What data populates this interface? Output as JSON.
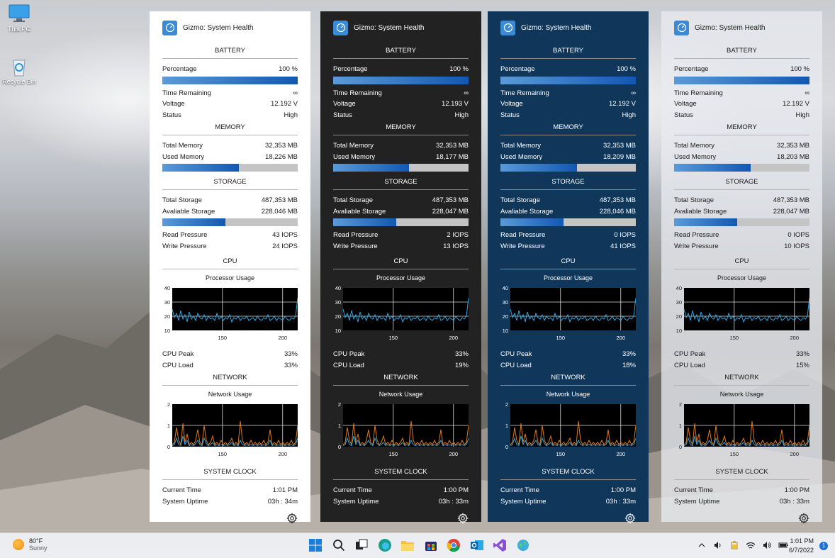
{
  "desktop": {
    "icons": [
      {
        "label": "This PC"
      },
      {
        "label": "Recycle Bin"
      }
    ]
  },
  "widgets": [
    {
      "theme": "light",
      "title": "Gizmo: System Health",
      "battery": {
        "heading": "BATTERY",
        "percentage_label": "Percentage",
        "percentage_value": "100 %",
        "percentage_fill": 1.0,
        "time_label": "Time Remaining",
        "time_value": "∞",
        "voltage_label": "Voltage",
        "voltage_value": "12.192 V",
        "status_label": "Status",
        "status_value": "High"
      },
      "memory": {
        "heading": "MEMORY",
        "total_label": "Total Memory",
        "total_value": "32,353 MB",
        "used_label": "Used Memory",
        "used_value": "18,226 MB",
        "used_fill": 0.563
      },
      "storage": {
        "heading": "STORAGE",
        "total_label": "Total Storage",
        "total_value": "487,353 MB",
        "avail_label": "Avaliable Storage",
        "avail_value": "228,046 MB",
        "avail_fill": 0.468,
        "read_label": "Read Pressure",
        "read_value": "43 IOPS",
        "write_label": "Write Pressure",
        "write_value": "24 IOPS"
      },
      "cpu": {
        "heading": "CPU",
        "chart_title": "Processor Usage",
        "peak_label": "CPU Peak",
        "peak_value": "33%",
        "load_label": "CPU Load",
        "load_value": "33%"
      },
      "network": {
        "heading": "NETWORK",
        "chart_title": "Network Usage"
      },
      "clock": {
        "heading": "SYSTEM CLOCK",
        "time_label": "Current Time",
        "time_value": "1:01 PM",
        "uptime_label": "System Uptime",
        "uptime_value": "03h : 34m"
      }
    },
    {
      "theme": "dark",
      "title": "Gizmo: System Health",
      "battery": {
        "heading": "BATTERY",
        "percentage_label": "Percentage",
        "percentage_value": "100 %",
        "percentage_fill": 1.0,
        "time_label": "Time Remaining",
        "time_value": "∞",
        "voltage_label": "Voltage",
        "voltage_value": "12.193 V",
        "status_label": "Status",
        "status_value": "High"
      },
      "memory": {
        "heading": "MEMORY",
        "total_label": "Total Memory",
        "total_value": "32,353 MB",
        "used_label": "Used Memory",
        "used_value": "18,177 MB",
        "used_fill": 0.562
      },
      "storage": {
        "heading": "STORAGE",
        "total_label": "Total Storage",
        "total_value": "487,353 MB",
        "avail_label": "Avaliable Storage",
        "avail_value": "228,047 MB",
        "avail_fill": 0.468,
        "read_label": "Read Pressure",
        "read_value": "2 IOPS",
        "write_label": "Write Pressure",
        "write_value": "13 IOPS"
      },
      "cpu": {
        "heading": "CPU",
        "chart_title": "Processor Usage",
        "peak_label": "CPU Peak",
        "peak_value": "33%",
        "load_label": "CPU Load",
        "load_value": "19%"
      },
      "network": {
        "heading": "NETWORK",
        "chart_title": "Network Usage"
      },
      "clock": {
        "heading": "SYSTEM CLOCK",
        "time_label": "Current Time",
        "time_value": "1:00 PM",
        "uptime_label": "System Uptime",
        "uptime_value": "03h : 33m"
      }
    },
    {
      "theme": "blue",
      "title": "Gizmo: System Health",
      "battery": {
        "heading": "BATTERY",
        "percentage_label": "Percentage",
        "percentage_value": "100 %",
        "percentage_fill": 1.0,
        "time_label": "Time Remaining",
        "time_value": "∞",
        "voltage_label": "Voltage",
        "voltage_value": "12.192 V",
        "status_label": "Status",
        "status_value": "High"
      },
      "memory": {
        "heading": "MEMORY",
        "total_label": "Total Memory",
        "total_value": "32,353 MB",
        "used_label": "Used Memory",
        "used_value": "18,209 MB",
        "used_fill": 0.563
      },
      "storage": {
        "heading": "STORAGE",
        "total_label": "Total Storage",
        "total_value": "487,353 MB",
        "avail_label": "Avaliable Storage",
        "avail_value": "228,046 MB",
        "avail_fill": 0.468,
        "read_label": "Read Pressure",
        "read_value": "0 IOPS",
        "write_label": "Write Pressure",
        "write_value": "41 IOPS"
      },
      "cpu": {
        "heading": "CPU",
        "chart_title": "Processor Usage",
        "peak_label": "CPU Peak",
        "peak_value": "33%",
        "load_label": "CPU Load",
        "load_value": "18%"
      },
      "network": {
        "heading": "NETWORK",
        "chart_title": "Network Usage"
      },
      "clock": {
        "heading": "SYSTEM CLOCK",
        "time_label": "Current Time",
        "time_value": "1:00 PM",
        "uptime_label": "System Uptime",
        "uptime_value": "03h : 33m"
      }
    },
    {
      "theme": "frost",
      "title": "Gizmo: System Health",
      "battery": {
        "heading": "BATTERY",
        "percentage_label": "Percentage",
        "percentage_value": "100 %",
        "percentage_fill": 1.0,
        "time_label": "Time Remaining",
        "time_value": "∞",
        "voltage_label": "Voltage",
        "voltage_value": "12.192 V",
        "status_label": "Status",
        "status_value": "High"
      },
      "memory": {
        "heading": "MEMORY",
        "total_label": "Total Memory",
        "total_value": "32,353 MB",
        "used_label": "Used Memory",
        "used_value": "18,203 MB",
        "used_fill": 0.563
      },
      "storage": {
        "heading": "STORAGE",
        "total_label": "Total Storage",
        "total_value": "487,353 MB",
        "avail_label": "Avaliable Storage",
        "avail_value": "228,047 MB",
        "avail_fill": 0.468,
        "read_label": "Read Pressure",
        "read_value": "0 IOPS",
        "write_label": "Write Pressure",
        "write_value": "10 IOPS"
      },
      "cpu": {
        "heading": "CPU",
        "chart_title": "Processor Usage",
        "peak_label": "CPU Peak",
        "peak_value": "33%",
        "load_label": "CPU Load",
        "load_value": "15%"
      },
      "network": {
        "heading": "NETWORK",
        "chart_title": "Network Usage"
      },
      "clock": {
        "heading": "SYSTEM CLOCK",
        "time_label": "Current Time",
        "time_value": "1:00 PM",
        "uptime_label": "System Uptime",
        "uptime_value": "03h : 33m"
      }
    }
  ],
  "charts": {
    "cpu": {
      "y_ticks": [
        "40",
        "30",
        "20",
        "10"
      ],
      "x_ticks": [
        "150",
        "200"
      ],
      "ylim": [
        10,
        40
      ],
      "series": [
        25,
        19,
        22,
        17,
        24,
        18,
        21,
        16,
        23,
        18,
        20,
        17,
        22,
        19,
        18,
        21,
        17,
        20,
        18,
        19,
        17,
        22,
        18,
        20,
        17,
        19,
        18,
        21,
        16,
        19,
        18,
        20,
        17,
        19,
        18,
        20,
        17,
        18,
        19,
        17,
        20,
        18,
        17,
        19,
        18,
        21,
        17,
        18,
        20,
        17,
        19,
        18,
        17,
        20,
        18,
        17,
        19,
        18,
        20,
        33
      ]
    },
    "network": {
      "y_ticks": [
        "2",
        "1",
        "0"
      ],
      "x_ticks": [
        "150",
        "200"
      ],
      "ylim": [
        0,
        2
      ],
      "series_orange": [
        0.1,
        0.2,
        0.9,
        0.3,
        0.1,
        1.1,
        0.2,
        0.6,
        0.1,
        0.2,
        0.1,
        0.3,
        0.8,
        0.2,
        0.1,
        1.0,
        0.3,
        0.1,
        0.2,
        0.5,
        0.1,
        0.2,
        0.1,
        0.3,
        0.1,
        0.2,
        0.1,
        0.2,
        0.4,
        0.1,
        0.2,
        0.1,
        1.2,
        0.3,
        0.1,
        0.2,
        0.1,
        0.3,
        0.1,
        0.2,
        0.1,
        0.2,
        0.1,
        0.3,
        0.1,
        0.2,
        0.8,
        0.1,
        0.2,
        0.1,
        0.3,
        0.1,
        0.2,
        0.1,
        0.2,
        0.1,
        0.3,
        0.1,
        0.2,
        1.0
      ],
      "series_blue": [
        0.05,
        0.1,
        0.4,
        0.1,
        0.05,
        0.5,
        0.1,
        0.3,
        0.05,
        0.1,
        0.05,
        0.15,
        0.3,
        0.1,
        0.05,
        0.4,
        0.15,
        0.05,
        0.1,
        0.2,
        0.05,
        0.1,
        0.05,
        0.1,
        0.05,
        0.1,
        0.05,
        0.1,
        0.2,
        0.05,
        0.1,
        0.05,
        0.3,
        0.1,
        0.05,
        0.1,
        0.05,
        0.1,
        0.05,
        0.1,
        0.05,
        0.1,
        0.05,
        0.1,
        0.05,
        0.1,
        0.3,
        0.05,
        0.1,
        0.05,
        0.1,
        0.05,
        0.1,
        0.05,
        0.1,
        0.05,
        0.1,
        0.05,
        0.1,
        0.4
      ]
    }
  },
  "taskbar": {
    "weather_temp": "80°F",
    "weather_desc": "Sunny",
    "clock_time": "1:01 PM",
    "clock_date": "6/7/2022",
    "notification_count": "1"
  },
  "colors": {
    "bar_gradient_start": "#5a9ad8",
    "bar_gradient_end": "#1258b3",
    "cpu_line": "#2ea8e6",
    "net_orange": "#e07a1a",
    "net_blue": "#2ea8e6"
  }
}
